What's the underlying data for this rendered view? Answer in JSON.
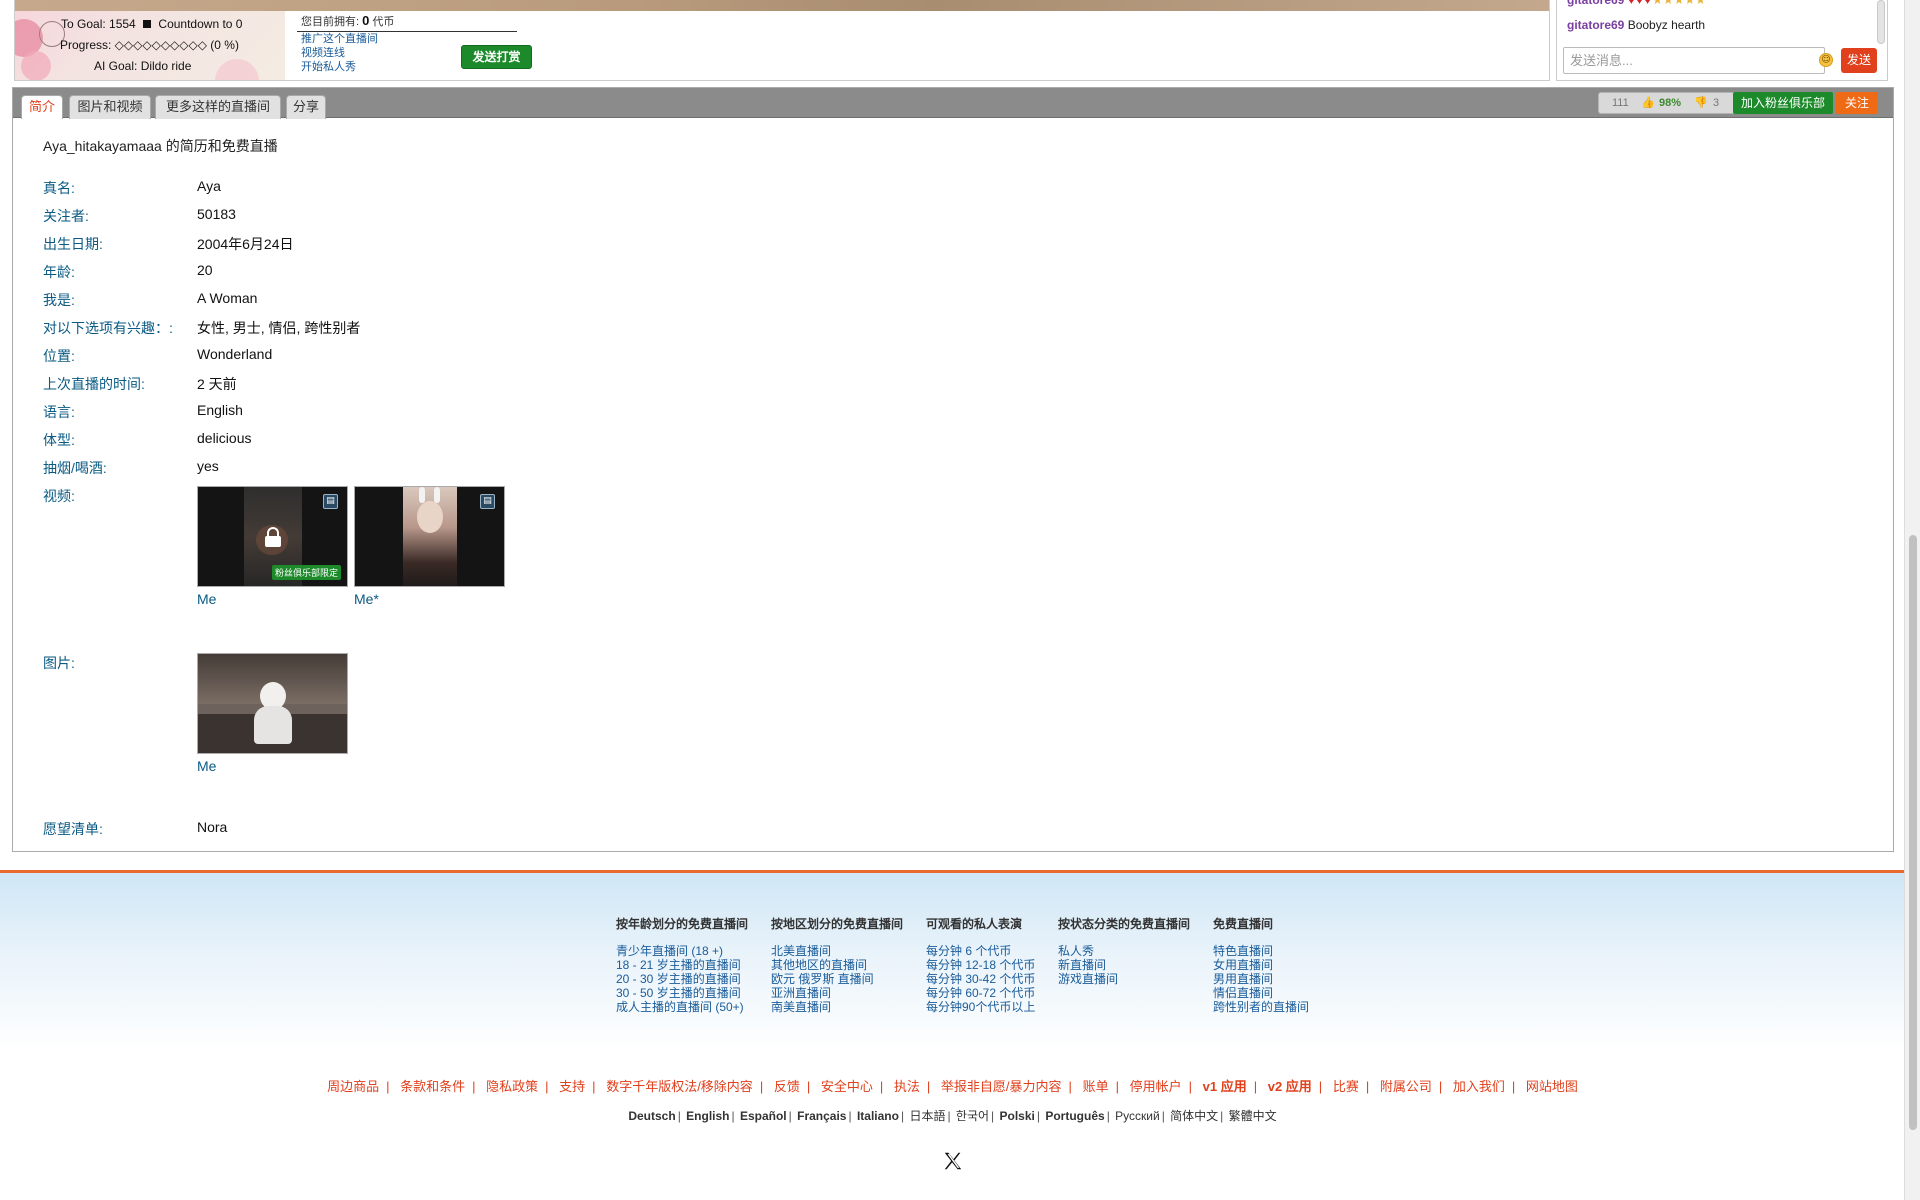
{
  "goal": {
    "to_goal": "To Goal: 1554",
    "countdown": "Countdown to 0",
    "progress": "Progress: ◇◇◇◇◇◇◇◇◇◇ (0 %)",
    "ai_goal": "AI Goal: Dildo ride"
  },
  "tip": {
    "token_prefix": "您目前拥有:",
    "token_count": "0",
    "token_unit": "代币",
    "links": [
      "推广这个直播间",
      "视频连线",
      "开始私人秀"
    ],
    "send_tip_label": "发送打赏"
  },
  "chat": {
    "messages": [
      {
        "user": "gitatore69",
        "text": ""
      },
      {
        "user": "gitatore69",
        "text": "Boobyz hearth"
      }
    ],
    "input_placeholder": "发送消息...",
    "send_label": "发送"
  },
  "tabs": [
    {
      "label": "简介",
      "active": true
    },
    {
      "label": "图片和视频",
      "active": false
    },
    {
      "label": "更多这样的直播间",
      "active": false
    },
    {
      "label": "分享",
      "active": false
    }
  ],
  "stats": {
    "count": "111",
    "up_percent": "98%",
    "down_count": "3"
  },
  "fanclub_label": "加入粉丝俱乐部",
  "follow_label": "关注",
  "bio": {
    "title": "Aya_hitakayamaaa 的简历和免费直播",
    "fields": [
      {
        "label": "真名:",
        "value": "Aya"
      },
      {
        "label": "关注者:",
        "value": "50183"
      },
      {
        "label": "出生日期:",
        "value": "2004年6月24日"
      },
      {
        "label": "年龄:",
        "value": "20"
      },
      {
        "label": "我是:",
        "value": "A Woman"
      },
      {
        "label": "对以下选项有兴趣：:",
        "value": "女性, 男士, 情侣, 跨性别者"
      },
      {
        "label": "位置:",
        "value": "Wonderland"
      },
      {
        "label": "上次直播的时间:",
        "value": "2 天前"
      },
      {
        "label": "语言:",
        "value": "English"
      },
      {
        "label": "体型:",
        "value": "delicious"
      },
      {
        "label": "抽烟/喝酒:",
        "value": "yes"
      }
    ],
    "videos_label": "视频:",
    "videos": [
      {
        "caption": "Me",
        "badge": "粉丝俱乐部限定",
        "locked": true
      },
      {
        "caption": "Me*",
        "badge": "",
        "locked": false
      }
    ],
    "photos_label": "图片:",
    "photos": [
      {
        "caption": "Me"
      }
    ],
    "wishlist_label": "愿望清单:",
    "wishlist_value": "Nora"
  },
  "footer": {
    "columns": [
      {
        "title": "按年龄划分的免费直播间",
        "links": [
          "青少年直播间 (18 +)",
          "18 - 21 岁主播的直播间",
          "20 - 30 岁主播的直播间",
          "30 - 50 岁主播的直播间",
          "成人主播的直播间 (50+)"
        ]
      },
      {
        "title": "按地区划分的免费直播间",
        "links": [
          "北美直播间",
          "其他地区的直播间",
          "欧元 俄罗斯 直播间",
          "亚洲直播间",
          "南美直播间"
        ]
      },
      {
        "title": "可观看的私人表演",
        "links": [
          "每分钟 6 个代币",
          "每分钟 12-18 个代币",
          "每分钟 30-42 个代币",
          "每分钟 60-72 个代币",
          "每分钟90个代币以上"
        ]
      },
      {
        "title": "按状态分类的免费直播间",
        "links": [
          "私人秀",
          "新直播间",
          "游戏直播间"
        ]
      },
      {
        "title": "免费直播间",
        "links": [
          "特色直播间",
          "女用直播间",
          "男用直播间",
          "情侣直播间",
          "跨性别者的直播间"
        ]
      }
    ],
    "legal": [
      "周边商品",
      "条款和条件",
      "隐私政策",
      "支持",
      "数字千年版权法/移除内容",
      "反馈",
      "安全中心",
      "执法",
      "举报非自愿/暴力内容",
      "账单",
      "停用帐户",
      "v1 应用",
      "v2 应用",
      "比赛",
      "附属公司",
      "加入我们",
      "网站地图"
    ],
    "languages": [
      "Deutsch",
      "English",
      "Español",
      "Français",
      "Italiano",
      "日本語",
      "한국어",
      "Polski",
      "Português",
      "Русский",
      "简体中文",
      "繁體中文"
    ]
  },
  "colors": {
    "accent_orange": "#e0401c",
    "green": "#1c8a2a",
    "link_blue": "#0a5a83"
  }
}
